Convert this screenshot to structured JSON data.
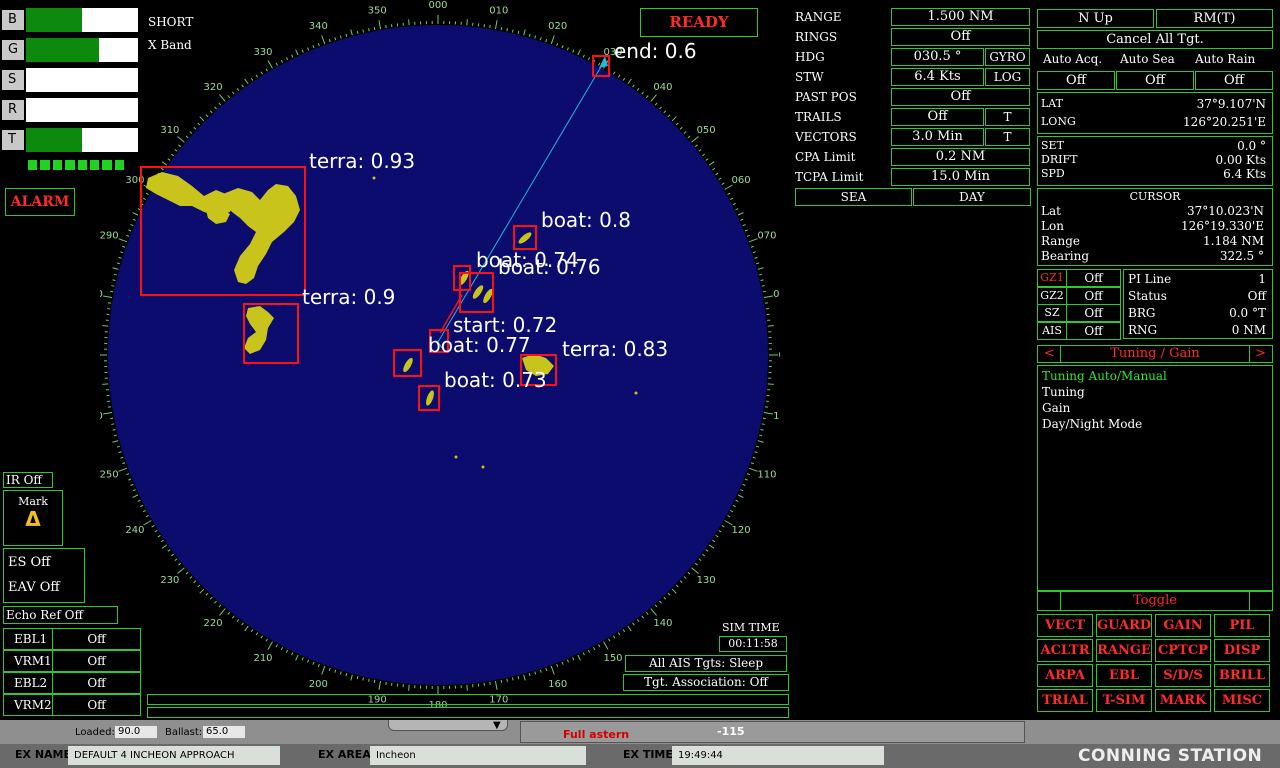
{
  "status": {
    "ready": "READY",
    "alarm": "ALARM"
  },
  "left_controls": {
    "items": [
      {
        "key": "B",
        "level": 0.5
      },
      {
        "key": "G",
        "level": 0.65
      },
      {
        "key": "S",
        "level": 0.0
      },
      {
        "key": "R",
        "level": 0.0
      },
      {
        "key": "T",
        "level": 0.5
      }
    ],
    "pulse": "SHORT",
    "band": "X Band",
    "ir": "IR Off",
    "mark": "Mark",
    "mark_symbol": "Δ",
    "es": "ES Off",
    "eav": "EAV Off",
    "echo_ref": "Echo Ref Off",
    "ebl_vrm": [
      {
        "name": "EBL1",
        "state": "Off"
      },
      {
        "name": "VRM1",
        "state": "Off"
      },
      {
        "name": "EBL2",
        "state": "Off"
      },
      {
        "name": "VRM2",
        "state": "Off"
      }
    ]
  },
  "radar": {
    "bearing_labels": [
      "000",
      "010",
      "020",
      "030",
      "040",
      "050",
      "060",
      "070",
      "080",
      "090",
      "100",
      "110",
      "120",
      "130",
      "140",
      "150",
      "160",
      "170",
      "180",
      "190",
      "200",
      "210",
      "220",
      "230",
      "240",
      "250",
      "260",
      "270",
      "280",
      "290",
      "300",
      "310",
      "320",
      "330",
      "340",
      "350"
    ],
    "detections": [
      {
        "label": "terra: 0.93"
      },
      {
        "label": "terra: 0.9"
      },
      {
        "label": "terra: 0.83"
      },
      {
        "label": "boat: 0.8"
      },
      {
        "label": "boat: 0.74"
      },
      {
        "label": "boat: 0.76"
      },
      {
        "label": "start: 0.72"
      },
      {
        "label": "boat: 0.77"
      },
      {
        "label": "boat: 0.73"
      },
      {
        "label": "end: 0.6"
      }
    ],
    "sim_time_label": "SIM TIME",
    "sim_time": "00:11:58",
    "ais_status": "All AIS Tgts: Sleep",
    "tgt_assoc": "Tgt. Association: Off"
  },
  "params": [
    {
      "label": "RANGE",
      "value": "1.500 NM",
      "extra": ""
    },
    {
      "label": "RINGS",
      "value": "Off",
      "extra": ""
    },
    {
      "label": "HDG",
      "value": "030.5 °",
      "extra": "GYRO"
    },
    {
      "label": "STW",
      "value": "6.4 Kts",
      "extra": "LOG"
    },
    {
      "label": "PAST POS",
      "value": "Off",
      "extra": ""
    },
    {
      "label": "TRAILS",
      "value": "Off",
      "extra": "T"
    },
    {
      "label": "VECTORS",
      "value": "3.0 Min",
      "extra": "T"
    },
    {
      "label": "CPA Limit",
      "value": "0.2 NM",
      "extra": ""
    },
    {
      "label": "TCPA Limit",
      "value": "15.0 Min",
      "extra": ""
    }
  ],
  "sea_day": {
    "sea": "SEA",
    "day": "DAY"
  },
  "right_panel": {
    "orientation": "N Up",
    "motion": "RM(T)",
    "cancel": "Cancel All Tgt.",
    "auto_labels": [
      "Auto Acq.",
      "Auto Sea",
      "Auto Rain"
    ],
    "auto_values": [
      "Off",
      "Off",
      "Off"
    ],
    "lat_label": "LAT",
    "lat": "37°9.107'N",
    "long_label": "LONG",
    "long": "126°20.251'E",
    "set_label": "SET",
    "set": "0.0 °",
    "drift_label": "DRIFT",
    "drift": "0.00 Kts",
    "spd_label": "SPD",
    "spd": "6.4 Kts",
    "cursor_title": "CURSOR",
    "cursor": [
      {
        "k": "Lat",
        "v": "37°10.023'N"
      },
      {
        "k": "Lon",
        "v": "126°19.330'E"
      },
      {
        "k": "Range",
        "v": "1.184 NM"
      },
      {
        "k": "Bearing",
        "v": "322.5 °"
      }
    ],
    "zones": [
      {
        "k": "GZ1",
        "v": "Off"
      },
      {
        "k": "GZ2",
        "v": "Off"
      },
      {
        "k": "SZ",
        "v": "Off"
      },
      {
        "k": "AIS",
        "v": "Off"
      }
    ],
    "pi": [
      {
        "k": "PI Line",
        "v": "1"
      },
      {
        "k": "Status",
        "v": "Off"
      },
      {
        "k": "BRG",
        "v": "0.0 °T"
      },
      {
        "k": "RNG",
        "v": "0 NM"
      }
    ],
    "tuning_nav_left": "<",
    "tuning_title": "Tuning / Gain",
    "tuning_nav_right": ">",
    "tuning_items": [
      "Tuning Auto/Manual",
      "Tuning",
      "Gain",
      "Day/Night Mode"
    ],
    "toggle": "Toggle",
    "func_buttons": [
      "VECT",
      "GUARD",
      "GAIN",
      "PIL",
      "ACLTR",
      "RANGE",
      "CPTCP",
      "DISP",
      "ARPA",
      "EBL",
      "S/D/S",
      "BRILL",
      "TRIAL",
      "T-SIM",
      "MARK",
      "MISC"
    ]
  },
  "lower_strip": {
    "loaded_label": "Loaded:",
    "loaded": "90.0",
    "ballast_label": "Ballast:",
    "ballast": "65.0",
    "full_astern": "Full astern",
    "value": "-115"
  },
  "bottom_bar": {
    "ex_name_label": "EX NAME:",
    "ex_name": "DEFAULT 4 INCHEON APPROACH",
    "ex_area_label": "EX AREA:",
    "ex_area": "Incheon",
    "ex_time_label": "EX TIME:",
    "ex_time": "19:49:44",
    "station": "CONNING STATION"
  }
}
